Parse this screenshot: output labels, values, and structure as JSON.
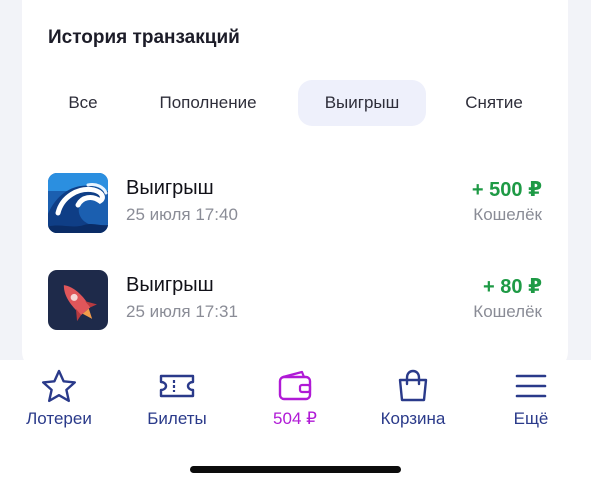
{
  "history": {
    "title": "История транзакций",
    "tabs": [
      {
        "label": "Все",
        "active": false
      },
      {
        "label": "Пополнение",
        "active": false
      },
      {
        "label": "Выигрыш",
        "active": true
      },
      {
        "label": "Снятие",
        "active": false
      }
    ],
    "transactions": [
      {
        "title": "Выигрыш",
        "time": "25 июля 17:40",
        "amount": "+ 500 ₽",
        "source": "Кошелёк",
        "icon": "wave-lottery-icon"
      },
      {
        "title": "Выигрыш",
        "time": "25 июля 17:31",
        "amount": "+ 80 ₽",
        "source": "Кошелёк",
        "icon": "rocket-lottery-icon"
      }
    ]
  },
  "nav": {
    "items": [
      {
        "label": "Лотереи",
        "icon": "star-icon",
        "active": false
      },
      {
        "label": "Билеты",
        "icon": "ticket-icon",
        "active": false
      },
      {
        "label": "504 ₽",
        "icon": "wallet-icon",
        "active": true
      },
      {
        "label": "Корзина",
        "icon": "shopping-bag-icon",
        "active": false
      },
      {
        "label": "Ещё",
        "icon": "menu-icon",
        "active": false
      }
    ]
  },
  "colors": {
    "accent": "#b01ad6",
    "nav_text": "#2a3a8a",
    "positive": "#1e9a45",
    "tab_active_bg": "#eef0fb"
  }
}
